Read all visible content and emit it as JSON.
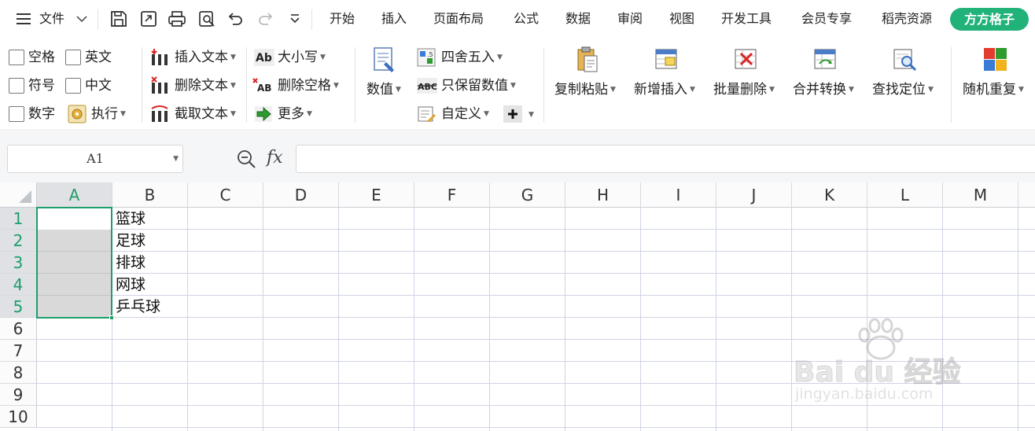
{
  "menu": {
    "file_label": "文件",
    "tabs": [
      "开始",
      "插入",
      "页面布局",
      "公式",
      "数据",
      "审阅",
      "视图",
      "开发工具",
      "会员专享",
      "稻壳资源"
    ],
    "special_tab": "方方格子"
  },
  "ribbon": {
    "checkbox_group": [
      "空格",
      "英文",
      "符号",
      "中文",
      "数字"
    ],
    "execute_label": "执行",
    "text_group": [
      "插入文本",
      "删除文本",
      "截取文本"
    ],
    "case_group": [
      "大小写",
      "删除空格",
      "更多"
    ],
    "numeric_label": "数值",
    "number_group": [
      "四舍五入",
      "只保留数值",
      "自定义"
    ],
    "big_buttons": [
      "复制粘贴",
      "新增插入",
      "批量删除",
      "合并转换",
      "查找定位",
      "随机重复"
    ]
  },
  "formula_bar": {
    "name_box": "A1",
    "fx_label": "fx",
    "formula_value": ""
  },
  "sheet": {
    "columns": [
      "A",
      "B",
      "C",
      "D",
      "E",
      "F",
      "G",
      "H",
      "I",
      "J",
      "K",
      "L",
      "M"
    ],
    "rows": [
      "1",
      "2",
      "3",
      "4",
      "5",
      "6",
      "7",
      "8",
      "9",
      "10"
    ],
    "column_b_values": [
      "篮球",
      "足球",
      "排球",
      "网球",
      "乒乓球"
    ],
    "selected_range": "A1:A5"
  },
  "watermark": {
    "brand": "Bai du 经验",
    "url": "jingyan.baidu.com"
  },
  "colors": {
    "accent": "#21b27a",
    "selection_border": "#1e9e6a",
    "selection_fill": "#d9d9d9",
    "active_header": "#dfe1e5"
  }
}
